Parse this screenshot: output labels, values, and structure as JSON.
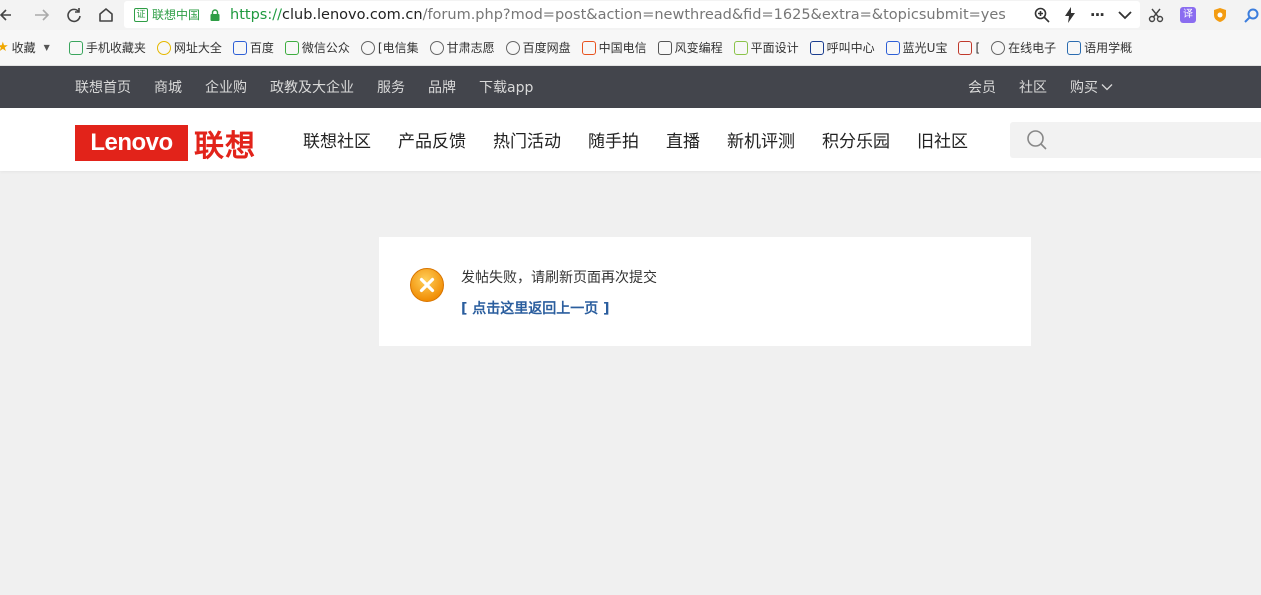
{
  "browser": {
    "cert_label": "联想中国",
    "cert_icon_char": "证",
    "url_scheme": "https://",
    "url_host": "club.lenovo.com.cn",
    "url_path": "/forum.php?mod=post&action=newthread&fid=1625&extra=&topicsubmit=yes",
    "more_glyph": "···",
    "translate_char": "译"
  },
  "bookmarks": {
    "favorites_label": "收藏",
    "items": [
      {
        "label": "手机收藏夹",
        "icon": "phone-icon",
        "color": "#3aa55d"
      },
      {
        "label": "网址大全",
        "icon": "globe-yellow-icon",
        "color": "#e5b800"
      },
      {
        "label": "百度",
        "icon": "baidu-paw-icon",
        "color": "#2e5fd6"
      },
      {
        "label": "微信公众",
        "icon": "wechat-icon",
        "color": "#3dad3f"
      },
      {
        "label": "[电信集",
        "icon": "globe-icon",
        "color": "#666666"
      },
      {
        "label": "甘肃志愿",
        "icon": "globe-icon",
        "color": "#666666"
      },
      {
        "label": "百度网盘",
        "icon": "globe-icon",
        "color": "#666666"
      },
      {
        "label": "中国电信",
        "icon": "china-telecom-icon",
        "color": "#e8531f"
      },
      {
        "label": "风变编程",
        "icon": "fengbian-icon",
        "color": "#555555"
      },
      {
        "label": "平面设计",
        "icon": "leaf-icon",
        "color": "#8bc34a"
      },
      {
        "label": "呼叫中心",
        "icon": "cti-icon",
        "color": "#1a3d8f"
      },
      {
        "label": "蓝光U宝",
        "icon": "baidu-paw-icon",
        "color": "#2e5fd6"
      },
      {
        "label": "[",
        "icon": "e-logo-icon",
        "color": "#c0392b"
      },
      {
        "label": "在线电子",
        "icon": "globe-icon",
        "color": "#666666"
      },
      {
        "label": "语用学概",
        "icon": "v-icon",
        "color": "#2b6cb0"
      }
    ]
  },
  "site_top": {
    "left_links": [
      "联想首页",
      "商城",
      "企业购",
      "政教及大企业",
      "服务",
      "品牌",
      "下载app"
    ],
    "right_links": [
      "会员",
      "社区",
      "购买"
    ]
  },
  "header": {
    "logo_text": "Lenovo",
    "logo_cn": "联想",
    "nav": [
      "联想社区",
      "产品反馈",
      "热门活动",
      "随手拍",
      "直播",
      "新机评测",
      "积分乐园",
      "旧社区"
    ],
    "search_placeholder": ""
  },
  "message": {
    "text": "发帖失败，请刷新页面再次提交",
    "link_text": "[ 点击这里返回上一页 ]"
  },
  "colors": {
    "brand_red": "#e2231a",
    "top_bar": "#43454c",
    "link_blue": "#2b5e9e",
    "error_orange": "#f39c12"
  }
}
